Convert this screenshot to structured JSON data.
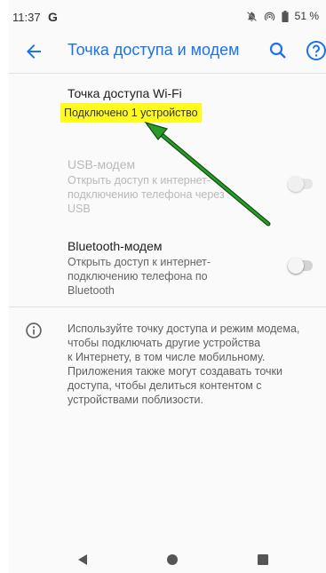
{
  "status_bar": {
    "time": "11:37",
    "g_logo": "G",
    "icons": [
      "mute-icon",
      "hotspot-icon",
      "battery-icon"
    ],
    "battery": "51 %"
  },
  "appbar": {
    "title": "Точка доступа и модем",
    "accent_color": "#1a73e8"
  },
  "items": {
    "wifi": {
      "title": "Точка доступа Wi-Fi",
      "subtitle": "Подключено 1 устройство",
      "highlight_color": "#fffb1e"
    },
    "usb": {
      "title": "USB-модем",
      "subtitle_lines": [
        "Открыть доступ к интернет-",
        "подключению телефона через",
        "USB"
      ],
      "enabled": false,
      "switch_on": false
    },
    "bluetooth": {
      "title": "Bluetooth-модем",
      "subtitle_lines": [
        "Открыть доступ к интернет-",
        "подключению телефона по",
        "Bluetooth"
      ],
      "enabled": true,
      "switch_on": false
    }
  },
  "info": {
    "icon": "info-icon",
    "lines": [
      "Используйте точку доступа и режим модема,",
      "чтобы подключать другие устройства",
      "к Интернету, в том числе мобильному.",
      "Приложения также могут создавать точки",
      "доступа, чтобы делиться контентом с",
      "устройствами поблизости."
    ]
  },
  "annotation": {
    "arrow_color": "#1f8a1f"
  }
}
